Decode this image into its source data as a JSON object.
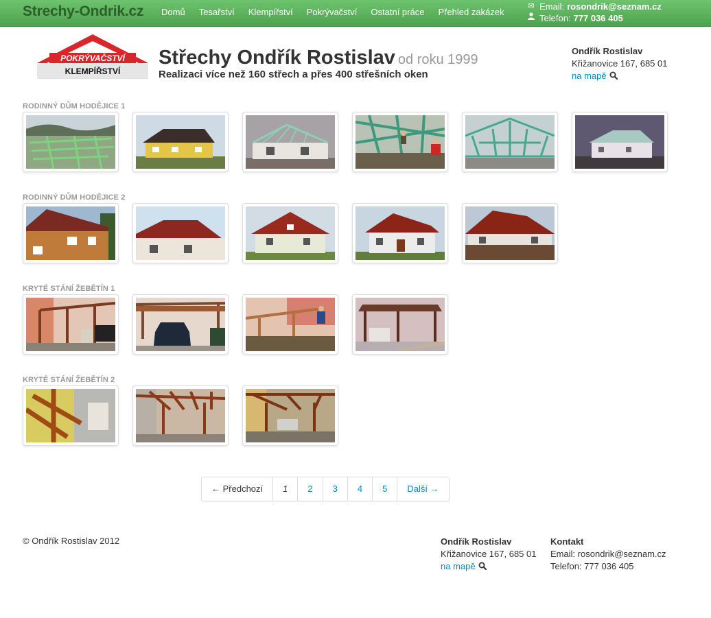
{
  "brand": "Strechy-Ondrik.cz",
  "nav": {
    "items": [
      "Domů",
      "Tesařství",
      "Klempířství",
      "Pokrývačství",
      "Ostatní práce",
      "Přehled zakázek"
    ]
  },
  "top_contact": {
    "email_label": "Email:",
    "email": "rosondrik@seznam.cz",
    "phone_label": "Telefon:",
    "phone": "777 036 405"
  },
  "logo": {
    "line1": "POKRÝVAČSTVÍ",
    "line2": "KLEMPÍŘSTVÍ"
  },
  "header": {
    "title": "Střechy Ondřík Rostislav",
    "subtitle": "od roku 1999",
    "tagline": "Realizaci více než 160 střech a přes 400 střešních oken"
  },
  "address": {
    "name": "Ondřík Rostislav",
    "street": "Křižanovice 167, 685 01",
    "map_link": "na mapě"
  },
  "galleries": [
    {
      "title": "Rodinný dům Hodějice 1",
      "count": 6
    },
    {
      "title": "Rodinný dům Hodějice 2",
      "count": 5
    },
    {
      "title": "Kryté stání Žebětín 1",
      "count": 4
    },
    {
      "title": "Kryté stání Žebětín 2",
      "count": 3
    }
  ],
  "pagination": {
    "prev": "← Předchozí",
    "pages": [
      "1",
      "2",
      "3",
      "4",
      "5"
    ],
    "current": "1",
    "next": "Další →"
  },
  "footer": {
    "copyright": "© Ondřík Rostislav 2012",
    "address_name": "Ondřík Rostislav",
    "address_street": "Křižanovice 167, 685 01",
    "map_link": "na mapě",
    "contact_heading": "Kontakt",
    "email_line": "Email: rosondrik@seznam.cz",
    "phone_line": "Telefon: 777 036 405"
  },
  "colors": {
    "accent": "#5cb85c",
    "link": "#0088cc",
    "logo_red": "#d9262c"
  }
}
